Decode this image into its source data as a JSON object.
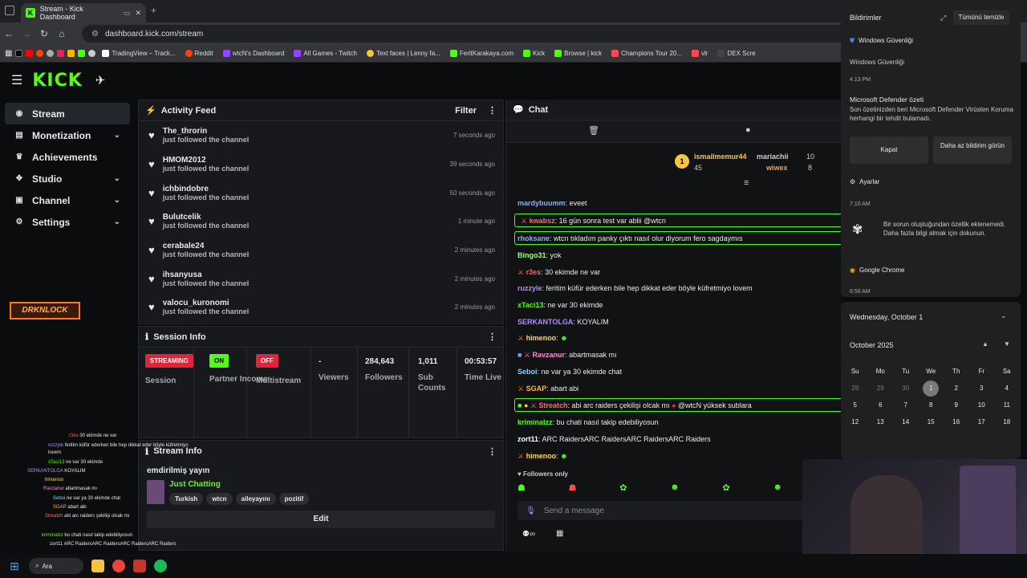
{
  "browser": {
    "tab_title": "Stream - Kick Dashboard",
    "url": "dashboard.kick.com/stream",
    "bookmarks": [
      "TradingView – Track...",
      "Reddit",
      "wtcN's Dashboard",
      "All Games - Twitch",
      "Text faces | Lenny fa...",
      "FeritKarakaya.com",
      "Kick",
      "Browse | kick",
      "Champions Tour 20...",
      "vlr",
      "DEX Scre"
    ]
  },
  "logo": "KICK",
  "sidebar": {
    "items": [
      "Stream",
      "Monetization",
      "Achievements",
      "Studio",
      "Channel",
      "Settings"
    ]
  },
  "activity": {
    "title": "Activity Feed",
    "filter": "Filter",
    "items": [
      {
        "name": "The_throrin",
        "sub": "just followed the channel",
        "time": "7 seconds ago"
      },
      {
        "name": "HMOM2012",
        "sub": "just followed the channel",
        "time": "39 seconds ago"
      },
      {
        "name": "ichbindobre",
        "sub": "just followed the channel",
        "time": "50 seconds ago"
      },
      {
        "name": "Bulutcelik",
        "sub": "just followed the channel",
        "time": "1 minute ago"
      },
      {
        "name": "cerabale24",
        "sub": "just followed the channel",
        "time": "2 minutes ago"
      },
      {
        "name": "ihsanyusa",
        "sub": "just followed the channel",
        "time": "2 minutes ago"
      },
      {
        "name": "valocu_kuronomi",
        "sub": "just followed the channel",
        "time": "2 minutes ago"
      }
    ]
  },
  "session": {
    "title": "Session Info",
    "streaming": "STREAMING",
    "session_label": "Session",
    "on": "ON",
    "partner": "Partner Income",
    "off": "OFF",
    "multistream": "Multistream",
    "viewers_val": "-",
    "viewers": "Viewers",
    "followers_val": "284,643",
    "followers": "Followers",
    "subs_val": "1,011",
    "subs": "Sub Counts",
    "time_val": "00:53:57",
    "time": "Time Live"
  },
  "stream": {
    "title": "Stream Info",
    "name": "emdirilmiş yayın",
    "category": "Just Chatting",
    "tags": [
      "Turkish",
      "wtcn",
      "aileyayını",
      "pozitif"
    ],
    "edit": "Edit"
  },
  "chat": {
    "title": "Chat",
    "top": [
      {
        "name": "ismailmemur44",
        "count": "45"
      },
      {
        "name": "mariachii",
        "count": "10"
      },
      {
        "name": "wiwex",
        "count": "8"
      }
    ],
    "messages": [
      {
        "u": "mardybuumm",
        "t": "eveet",
        "c": "#7fb3ff"
      },
      {
        "u": "kwabsz",
        "t": "16 gün sonra test var ablii @wtcn",
        "c": "#ff6b6b"
      },
      {
        "u": "rhoksane",
        "t": "wtcn tıkladım panky çıktı nasıl olur diyorum fero sagdaymıs",
        "c": "#7fb3ff"
      },
      {
        "u": "Bingo31",
        "t": "yok",
        "c": "#9cff7a"
      },
      {
        "u": "r3es",
        "t": "30 ekimde ne var",
        "c": "#ff5f5f"
      },
      {
        "u": "ruzzyle",
        "t": "feritim küfür ederken bile hep dikkat eder böyle küfretmiyo lovem",
        "c": "#b58cff"
      },
      {
        "u": "xTaci13",
        "t": "ne var 30 ekimde",
        "c": "#53fc18"
      },
      {
        "u": "SERKANTOLGA",
        "t": "KOYALIM",
        "c": "#b58cff"
      },
      {
        "u": "himenoo",
        "t": "",
        "c": "#ffd84d"
      },
      {
        "u": "Ravzanur",
        "t": "abartmasak mı",
        "c": "#ff8ad8"
      },
      {
        "u": "Seboi",
        "t": "ne var ya 30 ekimde chat",
        "c": "#7fd6ff"
      },
      {
        "u": "SGAP",
        "t": "abart abi",
        "c": "#ffb14d"
      },
      {
        "u": "Streatch",
        "t": "abi arc raiders çekilişi olcak mı",
        "t2": "@wtcN yüksek sublara",
        "c": "#ff6b6b"
      },
      {
        "u": "kriminalzz",
        "t": "bu chati nasıl takip edebiliyosun",
        "c": "#53fc18"
      },
      {
        "u": "zort11",
        "t": "ARC RaidersARC RaidersARC RaidersARC Raiders",
        "c": "#ffffff"
      },
      {
        "u": "himenoo",
        "t": "",
        "c": "#ffd84d"
      }
    ],
    "followers_only": "Followers only",
    "placeholder": "Send a message"
  },
  "notifications": {
    "title": "Bildirimler",
    "clear": "Tümünü temizle",
    "group1": "Windows Güvenliği",
    "sub1": "Windows Güvenliği",
    "time1": "4:13 PM",
    "h1": "Microsoft Defender özeti",
    "b1": "Son özetinizden beri Microsoft Defender Virüsten Koruma herhangi bir tehdit bulamadı.",
    "btn1": "Kapat",
    "btn2": "Daha az bildirim görün",
    "settings": "Ayarlar",
    "time2": "7:10 AM",
    "b2": "Bir sorun oluştuğundan özellik eklenemedi.",
    "b2b": "Daha fazla bilgi almak için dokunun.",
    "group3": "Google Chrome",
    "time3": "6:56 AM"
  },
  "calendar": {
    "date": "Wednesday, October 1",
    "month": "October 2025",
    "days": [
      "Su",
      "Mo",
      "Tu",
      "We",
      "Th",
      "Fr",
      "Sa"
    ],
    "cells": [
      "28",
      "29",
      "30",
      "1",
      "2",
      "3",
      "4",
      "5",
      "6",
      "7",
      "8",
      "9",
      "10",
      "11",
      "12",
      "13",
      "14",
      "15",
      "16",
      "17",
      "18"
    ],
    "today": "1"
  },
  "taskbar": {
    "search": "Ara"
  },
  "overlay": {
    "logo": "DRKNLOCK"
  }
}
